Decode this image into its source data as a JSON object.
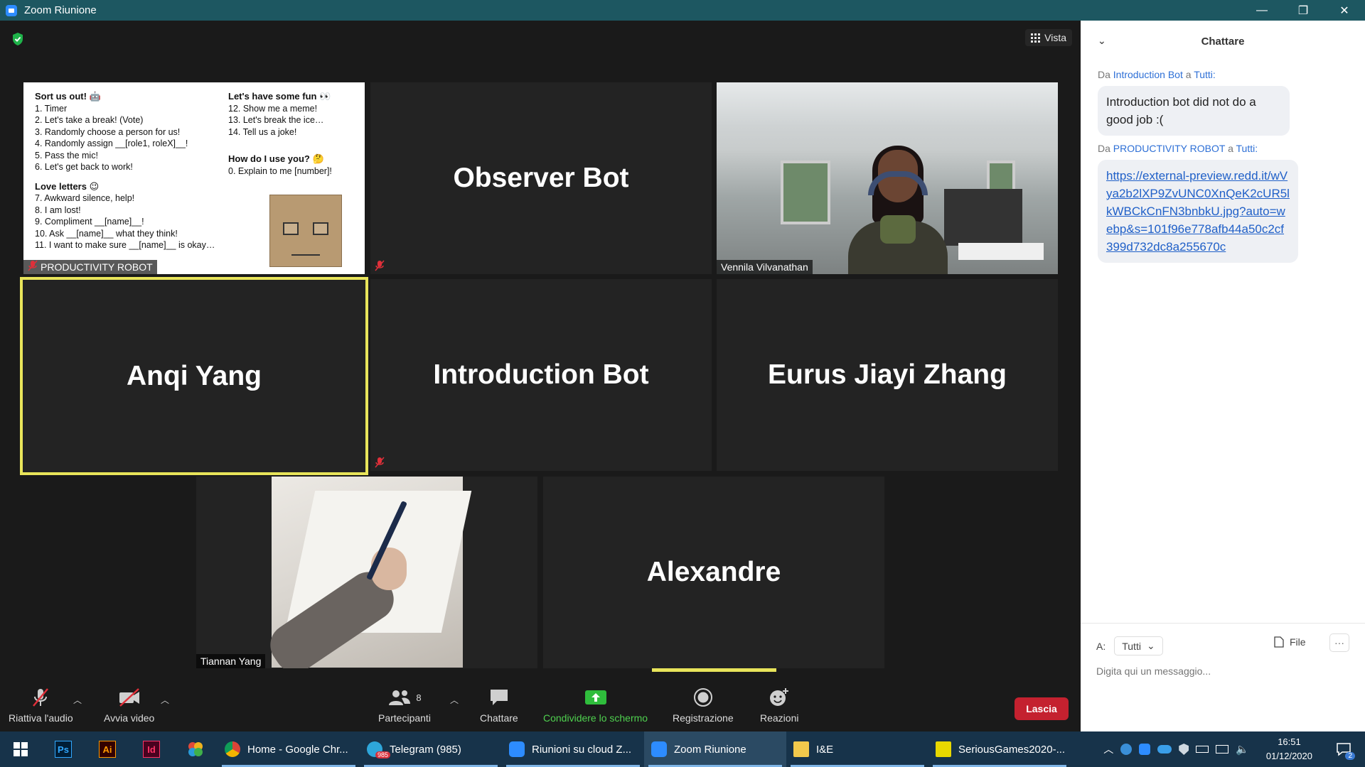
{
  "window": {
    "title": "Zoom Riunione",
    "controls": [
      "—",
      "❐",
      "✕"
    ]
  },
  "meeting": {
    "view_label": "Vista",
    "tiles": [
      {
        "id": "productivity-robot",
        "name": "PRODUCTIVITY ROBOT"
      },
      {
        "id": "observer-bot",
        "name": "Observer Bot"
      },
      {
        "id": "vennila",
        "name": "Vennila Vilvanathan"
      },
      {
        "id": "anqi",
        "name": "Anqi Yang"
      },
      {
        "id": "intro-bot",
        "name": "Introduction Bot"
      },
      {
        "id": "eurus",
        "name": "Eurus Jiayi Zhang"
      },
      {
        "id": "tiannan",
        "name": "Tiannan Yang"
      },
      {
        "id": "alexandre",
        "name": "Alexandre"
      }
    ],
    "slide": {
      "col1": [
        {
          "bold": true,
          "text": "Sort us out! 🤖"
        },
        {
          "text": "1. Timer"
        },
        {
          "text": "2. Let's take a break! (Vote)"
        },
        {
          "text": "3. Randomly choose a person for us!"
        },
        {
          "text": "4. Randomly assign __[role1, roleX]__!"
        },
        {
          "text": "5. Pass the mic!"
        },
        {
          "text": "6. Let's get back to work!"
        },
        {
          "gap": true
        },
        {
          "bold": true,
          "text": "Love letters 😉"
        },
        {
          "text": "7. Awkward silence, help!"
        },
        {
          "text": "8. I am lost!"
        },
        {
          "text": "9. Compliment __[name]__!"
        },
        {
          "text": "10. Ask __[name]__ what they think!"
        },
        {
          "text": "11. I want to make sure __[name]__ is okay…"
        }
      ],
      "col2": [
        {
          "bold": true,
          "text": "Let's have some fun 👀"
        },
        {
          "text": "12. Show me a meme!"
        },
        {
          "text": "13. Let's break the ice…"
        },
        {
          "text": "14. Tell us a joke!"
        },
        {
          "gap": true
        },
        {
          "gap": true
        },
        {
          "bold": true,
          "text": "How do I use you? 🤔"
        },
        {
          "text": "0. Explain to me [number]!"
        }
      ]
    }
  },
  "toolbar": {
    "audio_label": "Riattiva l'audio",
    "video_label": "Avvia video",
    "participants_label": "Partecipanti",
    "participants_count": "8",
    "chat_label": "Chattare",
    "share_label": "Condividere lo schermo",
    "record_label": "Registrazione",
    "reactions_label": "Reazioni",
    "leave_label": "Lascia"
  },
  "chat": {
    "title": "Chattare",
    "messages": [
      {
        "prefix": "Da",
        "from": "Introduction Bot",
        "to_word": "a",
        "to": "Tutti:",
        "text": "Introduction bot did not do a good job :("
      },
      {
        "prefix": "Da",
        "from": "PRODUCTIVITY ROBOT",
        "to_word": "a",
        "to": "Tutti:",
        "link": "https://external-preview.redd.it/wVya2b2lXP9ZvUNC0XnQeK2cUR5lkWBCkCnFN3bnbkU.jpg?auto=webp&s=101f96e778afb44a50c2cf399d732dc8a255670c"
      }
    ],
    "to_label": "A:",
    "to_value": "Tutti",
    "file_label": "File",
    "input_placeholder": "Digita qui un messaggio..."
  },
  "taskbar": {
    "pinned": [
      {
        "name": "photoshop",
        "label": "Ps",
        "color": "#31a8ff",
        "bg": "#001e36"
      },
      {
        "name": "illustrator",
        "label": "Ai",
        "color": "#ff9a00",
        "bg": "#330000"
      },
      {
        "name": "indesign",
        "label": "Id",
        "color": "#ff3366",
        "bg": "#49021f"
      }
    ],
    "open": [
      {
        "name": "chrome",
        "label": "Home - Google Chr..."
      },
      {
        "name": "telegram",
        "label": "Telegram (985)",
        "badge": "985"
      },
      {
        "name": "zoom-cloud",
        "label": "Riunioni su cloud Z..."
      },
      {
        "name": "zoom-meeting",
        "label": "Zoom Riunione",
        "active": true
      },
      {
        "name": "folder",
        "label": "I&E"
      },
      {
        "name": "pdf",
        "label": "SeriousGames2020-..."
      }
    ],
    "time": "16:51",
    "date": "01/12/2020",
    "notif_count": "2"
  },
  "colors": {
    "titlebar": "#1d5761",
    "active_speaker": "#e8e45a",
    "leave": "#c4212f",
    "share_green": "#4fd14f",
    "chat_name": "#2d6fd6"
  }
}
